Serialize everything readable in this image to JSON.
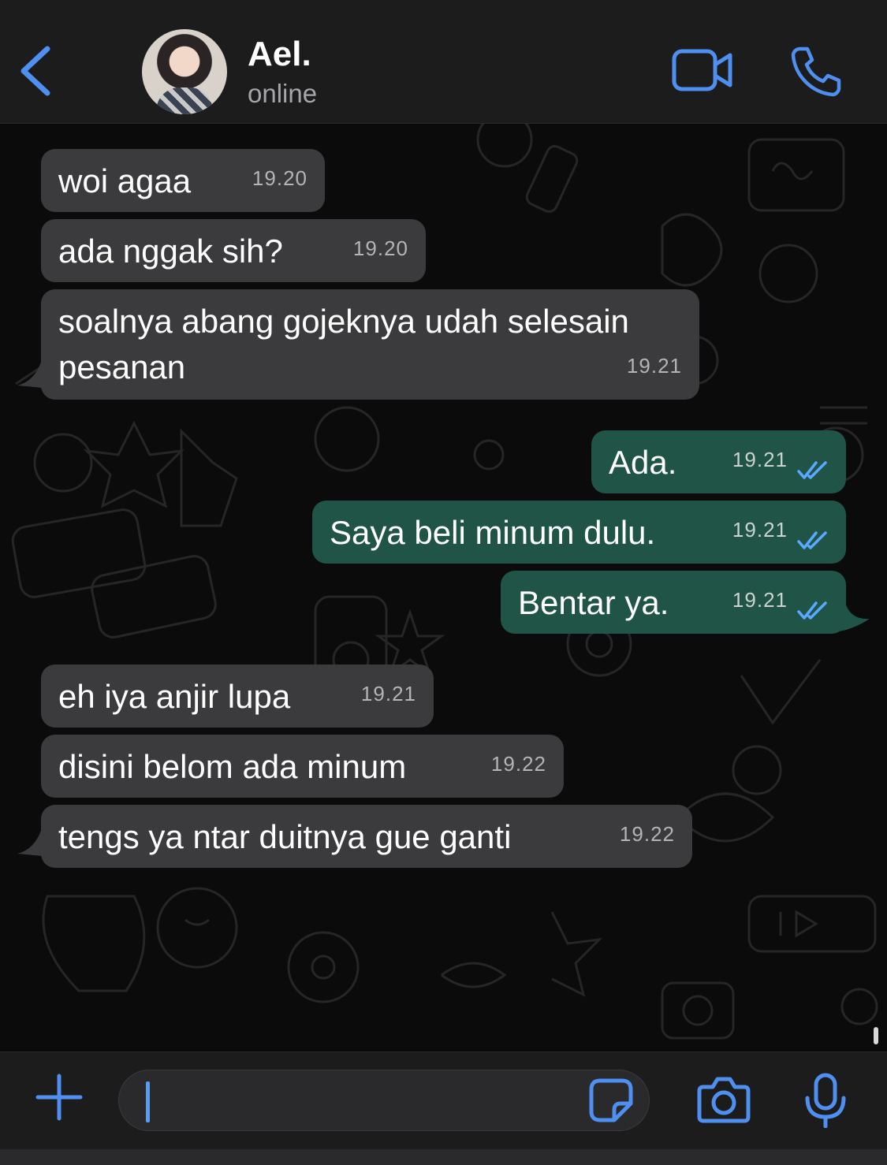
{
  "header": {
    "contact_name": "Ael.",
    "status": "online"
  },
  "messages": [
    {
      "dir": "in",
      "text": "woi agaa",
      "time": "19.20"
    },
    {
      "dir": "in",
      "text": "ada nggak sih?",
      "time": "19.20"
    },
    {
      "dir": "in",
      "text": "soalnya abang gojeknya udah selesain\npesanan",
      "time": "19.21"
    },
    {
      "dir": "out",
      "text": "Ada.",
      "time": "19.21",
      "read": true
    },
    {
      "dir": "out",
      "text": "Saya beli minum dulu.",
      "time": "19.21",
      "read": true
    },
    {
      "dir": "out",
      "text": "Bentar ya.",
      "time": "19.21",
      "read": true
    },
    {
      "dir": "in",
      "text": "eh iya anjir lupa",
      "time": "19.21"
    },
    {
      "dir": "in",
      "text": "disini belom ada minum",
      "time": "19.22"
    },
    {
      "dir": "in",
      "text": "tengs ya ntar duitnya gue ganti",
      "time": "19.22"
    }
  ],
  "composer": {
    "value": ""
  },
  "icons": {
    "back": "chevron-left-icon",
    "video": "video-camera-icon",
    "call": "phone-icon",
    "attach": "plus-icon",
    "sticker": "sticker-icon",
    "camera": "camera-icon",
    "mic": "microphone-icon"
  },
  "colors": {
    "accent": "#4f8ff0",
    "incoming_bubble": "#3b3b3d",
    "outgoing_bubble": "#1f5446",
    "read_ticks": "#5aa8ff"
  }
}
